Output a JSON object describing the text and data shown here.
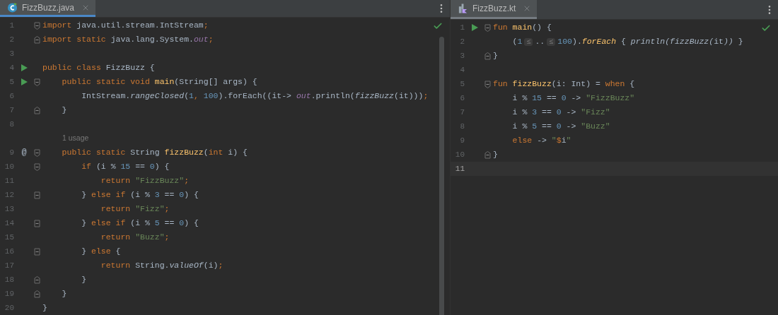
{
  "panes": [
    {
      "tab": {
        "label": "FizzBuzz.java",
        "kind": "java",
        "focused": true
      },
      "inspection_passed": true,
      "scrollbar": true,
      "lines": [
        {
          "kind": "code",
          "n": "1",
          "fold": {
            "kind": "open"
          },
          "current": false,
          "tokens": [
            {
              "kind": "kw",
              "t": "import "
            },
            {
              "kind": "plain",
              "t": "java.util.stream.IntStream"
            },
            {
              "kind": "kw",
              "t": ";"
            }
          ]
        },
        {
          "kind": "code",
          "n": "2",
          "fold": {
            "kind": "close"
          },
          "current": false,
          "tokens": [
            {
              "kind": "kw",
              "t": "import static "
            },
            {
              "kind": "plain",
              "t": "java.lang.System."
            },
            {
              "kind": "field",
              "t": "out"
            },
            {
              "kind": "kw",
              "t": ";"
            }
          ]
        },
        {
          "kind": "code",
          "n": "3",
          "current": false
        },
        {
          "kind": "code",
          "n": "4",
          "gutter": {
            "kind": "run"
          },
          "current": false,
          "tokens": [
            {
              "kind": "kw",
              "t": "public class "
            },
            {
              "kind": "plain",
              "t": "FizzBuzz {"
            }
          ]
        },
        {
          "kind": "code",
          "n": "5",
          "gutter": {
            "kind": "run"
          },
          "fold": {
            "kind": "open"
          },
          "current": false,
          "tokens": [
            {
              "kind": "kw",
              "t": "    public static void "
            },
            {
              "kind": "decl",
              "t": "main"
            },
            {
              "kind": "plain",
              "t": "(String[] args) {"
            }
          ]
        },
        {
          "kind": "code",
          "n": "6",
          "current": false,
          "tokens": [
            {
              "kind": "plain",
              "t": "        IntStream."
            },
            {
              "kind": "italic",
              "t": "rangeClosed"
            },
            {
              "kind": "plain",
              "t": "("
            },
            {
              "kind": "num",
              "t": "1"
            },
            {
              "kind": "kw",
              "t": ", "
            },
            {
              "kind": "num",
              "t": "100"
            },
            {
              "kind": "plain",
              "t": ").forEach((it-> "
            },
            {
              "kind": "field",
              "t": "out"
            },
            {
              "kind": "plain",
              "t": ".println("
            },
            {
              "kind": "italic",
              "t": "fizzBuzz"
            },
            {
              "kind": "plain",
              "t": "(it)))"
            },
            {
              "kind": "kw",
              "t": ";"
            }
          ]
        },
        {
          "kind": "code",
          "n": "7",
          "fold": {
            "kind": "close"
          },
          "current": false,
          "tokens": [
            {
              "kind": "plain",
              "t": "    }"
            }
          ]
        },
        {
          "kind": "code",
          "n": "8",
          "current": false
        },
        {
          "kind": "usage",
          "text": "1 usage"
        },
        {
          "kind": "code",
          "n": "9",
          "gutter": {
            "kind": "text",
            "text": "@"
          },
          "fold": {
            "kind": "open"
          },
          "current": false,
          "tokens": [
            {
              "kind": "kw",
              "t": "    public static "
            },
            {
              "kind": "plain",
              "t": "String "
            },
            {
              "kind": "decl",
              "t": "fizzBuzz"
            },
            {
              "kind": "plain",
              "t": "("
            },
            {
              "kind": "kw",
              "t": "int "
            },
            {
              "kind": "plain",
              "t": "i) {"
            }
          ]
        },
        {
          "kind": "code",
          "n": "10",
          "fold": {
            "kind": "open"
          },
          "current": false,
          "tokens": [
            {
              "kind": "kw",
              "t": "        if "
            },
            {
              "kind": "plain",
              "t": "(i % "
            },
            {
              "kind": "num",
              "t": "15"
            },
            {
              "kind": "plain",
              "t": " == "
            },
            {
              "kind": "num",
              "t": "0"
            },
            {
              "kind": "plain",
              "t": ") {"
            }
          ]
        },
        {
          "kind": "code",
          "n": "11",
          "current": false,
          "tokens": [
            {
              "kind": "kw",
              "t": "            return "
            },
            {
              "kind": "str",
              "t": "\"FizzBuzz\""
            },
            {
              "kind": "kw",
              "t": ";"
            }
          ]
        },
        {
          "kind": "code",
          "n": "12",
          "fold": {
            "kind": "mid"
          },
          "current": false,
          "tokens": [
            {
              "kind": "plain",
              "t": "        } "
            },
            {
              "kind": "kw",
              "t": "else if "
            },
            {
              "kind": "plain",
              "t": "(i % "
            },
            {
              "kind": "num",
              "t": "3"
            },
            {
              "kind": "plain",
              "t": " == "
            },
            {
              "kind": "num",
              "t": "0"
            },
            {
              "kind": "plain",
              "t": ") {"
            }
          ]
        },
        {
          "kind": "code",
          "n": "13",
          "current": false,
          "tokens": [
            {
              "kind": "kw",
              "t": "            return "
            },
            {
              "kind": "str",
              "t": "\"Fizz\""
            },
            {
              "kind": "kw",
              "t": ";"
            }
          ]
        },
        {
          "kind": "code",
          "n": "14",
          "fold": {
            "kind": "mid"
          },
          "current": false,
          "tokens": [
            {
              "kind": "plain",
              "t": "        } "
            },
            {
              "kind": "kw",
              "t": "else if "
            },
            {
              "kind": "plain",
              "t": "(i % "
            },
            {
              "kind": "num",
              "t": "5"
            },
            {
              "kind": "plain",
              "t": " == "
            },
            {
              "kind": "num",
              "t": "0"
            },
            {
              "kind": "plain",
              "t": ") {"
            }
          ]
        },
        {
          "kind": "code",
          "n": "15",
          "current": false,
          "tokens": [
            {
              "kind": "kw",
              "t": "            return "
            },
            {
              "kind": "str",
              "t": "\"Buzz\""
            },
            {
              "kind": "kw",
              "t": ";"
            }
          ]
        },
        {
          "kind": "code",
          "n": "16",
          "fold": {
            "kind": "mid"
          },
          "current": false,
          "tokens": [
            {
              "kind": "plain",
              "t": "        } "
            },
            {
              "kind": "kw",
              "t": "else "
            },
            {
              "kind": "plain",
              "t": "{"
            }
          ]
        },
        {
          "kind": "code",
          "n": "17",
          "current": false,
          "tokens": [
            {
              "kind": "kw",
              "t": "            return "
            },
            {
              "kind": "plain",
              "t": "String."
            },
            {
              "kind": "italic",
              "t": "valueOf"
            },
            {
              "kind": "plain",
              "t": "(i)"
            },
            {
              "kind": "kw",
              "t": ";"
            }
          ]
        },
        {
          "kind": "code",
          "n": "18",
          "fold": {
            "kind": "close"
          },
          "current": false,
          "tokens": [
            {
              "kind": "plain",
              "t": "        }"
            }
          ]
        },
        {
          "kind": "code",
          "n": "19",
          "fold": {
            "kind": "close"
          },
          "current": false,
          "tokens": [
            {
              "kind": "plain",
              "t": "    }"
            }
          ]
        },
        {
          "kind": "code",
          "n": "20",
          "current": false,
          "tokens": [
            {
              "kind": "plain",
              "t": "}"
            }
          ]
        }
      ]
    },
    {
      "tab": {
        "label": "FizzBuzz.kt",
        "kind": "kotlin",
        "focused": false
      },
      "inspection_passed": true,
      "scrollbar": false,
      "lines": [
        {
          "kind": "code",
          "n": "1",
          "gutter": {
            "kind": "run"
          },
          "fold": {
            "kind": "open"
          },
          "current": false,
          "tokens": [
            {
              "kind": "kw",
              "t": "fun "
            },
            {
              "kind": "decl",
              "t": "main"
            },
            {
              "kind": "plain",
              "t": "() {"
            }
          ]
        },
        {
          "kind": "code",
          "n": "2",
          "current": false,
          "tokens": [
            {
              "kind": "plain",
              "t": "    ("
            },
            {
              "kind": "num",
              "t": "1"
            },
            {
              "kind": "hint",
              "t": "≤"
            },
            {
              "kind": "plain",
              "t": ".."
            },
            {
              "kind": "hint",
              "t": "≤"
            },
            {
              "kind": "num",
              "t": "100"
            },
            {
              "kind": "plain",
              "t": ")."
            },
            {
              "kind": "ext",
              "t": "forEach"
            },
            {
              "kind": "plain",
              "t": " { "
            },
            {
              "kind": "italic",
              "t": "println(fizzBuzz("
            },
            {
              "kind": "plain",
              "t": "it"
            },
            {
              "kind": "italic",
              "t": "))"
            },
            {
              "kind": "plain",
              "t": " }"
            }
          ]
        },
        {
          "kind": "code",
          "n": "3",
          "fold": {
            "kind": "close"
          },
          "current": false,
          "tokens": [
            {
              "kind": "plain",
              "t": "}"
            }
          ]
        },
        {
          "kind": "code",
          "n": "4",
          "current": false
        },
        {
          "kind": "code",
          "n": "5",
          "fold": {
            "kind": "open"
          },
          "current": false,
          "tokens": [
            {
              "kind": "kw",
              "t": "fun "
            },
            {
              "kind": "decl",
              "t": "fizzBuzz"
            },
            {
              "kind": "plain",
              "t": "(i: Int) = "
            },
            {
              "kind": "kw",
              "t": "when "
            },
            {
              "kind": "plain",
              "t": "{"
            }
          ]
        },
        {
          "kind": "code",
          "n": "6",
          "current": false,
          "tokens": [
            {
              "kind": "plain",
              "t": "    i % "
            },
            {
              "kind": "num",
              "t": "15"
            },
            {
              "kind": "plain",
              "t": " == "
            },
            {
              "kind": "num",
              "t": "0"
            },
            {
              "kind": "plain",
              "t": " -> "
            },
            {
              "kind": "str",
              "t": "\"FizzBuzz\""
            }
          ]
        },
        {
          "kind": "code",
          "n": "7",
          "current": false,
          "tokens": [
            {
              "kind": "plain",
              "t": "    i % "
            },
            {
              "kind": "num",
              "t": "3"
            },
            {
              "kind": "plain",
              "t": " == "
            },
            {
              "kind": "num",
              "t": "0"
            },
            {
              "kind": "plain",
              "t": " -> "
            },
            {
              "kind": "str",
              "t": "\"Fizz\""
            }
          ]
        },
        {
          "kind": "code",
          "n": "8",
          "current": false,
          "tokens": [
            {
              "kind": "plain",
              "t": "    i % "
            },
            {
              "kind": "num",
              "t": "5"
            },
            {
              "kind": "plain",
              "t": " == "
            },
            {
              "kind": "num",
              "t": "0"
            },
            {
              "kind": "plain",
              "t": " -> "
            },
            {
              "kind": "str",
              "t": "\"Buzz\""
            }
          ]
        },
        {
          "kind": "code",
          "n": "9",
          "current": false,
          "tokens": [
            {
              "kind": "kw",
              "t": "    else "
            },
            {
              "kind": "plain",
              "t": "-> "
            },
            {
              "kind": "str",
              "t": "\""
            },
            {
              "kind": "kw",
              "t": "$"
            },
            {
              "kind": "plain",
              "t": "i"
            },
            {
              "kind": "str",
              "t": "\""
            }
          ]
        },
        {
          "kind": "code",
          "n": "10",
          "fold": {
            "kind": "close"
          },
          "current": false,
          "tokens": [
            {
              "kind": "plain",
              "t": "}"
            }
          ]
        },
        {
          "kind": "code",
          "n": "11",
          "current": true
        }
      ]
    }
  ]
}
